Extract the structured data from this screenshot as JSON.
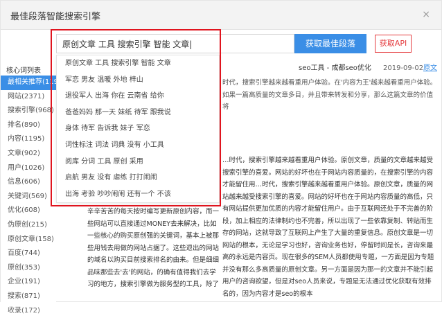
{
  "title": "最佳段落智能搜索引擎",
  "close": "×",
  "search": {
    "value": "原创文章 工具 搜索引擎 智能 文章|",
    "button": "获取最佳段落",
    "api": "获取API"
  },
  "dropdown": [
    "原创文章 工具 搜索引擎 智能 文章",
    "军恋 男友 温暖 外地 梓山",
    "退役军人 出海 你在 云南省 给你",
    "爸爸妈妈 那一天 妹纸 待军 跟我说",
    "身体 待军 告诉我 妹子 军恋",
    "词性标注 词法 词典 没有 小工具",
    "阅库 分词 工具 原创 采用",
    "启航 男友 没有 虐练 打打闹闹",
    "出海 考验 吵吵闹闹 还有一个 不该"
  ],
  "sidebar": {
    "header": "核心词列表",
    "items": [
      "最相关推荐(1194",
      "网站(2371)",
      "搜索引擎(968)",
      "排名(890)",
      "内容(1195)",
      "文章(902)",
      "用户(1026)",
      "信息(606)",
      "关键词(569)",
      "优化(608)",
      "伪原创(215)",
      "原创文章(158)",
      "百度(744)",
      "原创(353)",
      "企业(191)",
      "搜索(871)",
      "收录(172)"
    ]
  },
  "result": {
    "source": "seo工具 - 成都seo优化",
    "date": "2019-09-02",
    "link": "原文"
  },
  "para_right_top": "时代，搜索引擎越来越看重用户体验。在'内容为王'越来越看重用户体验。如果一篇高质量的文章多目，并且带来转发和分享，那么这篇文章的价值将",
  "para_right": "…时代，搜索引擎越来越看重用户体验。原创文章，质量的文章越来越受搜索引擎的喜爱。网站的好坏也在于网站内容质量的，在搜索引擎的内容才能留住用…时代，搜索引擎越来越看重用户体验。原创文章，质量的网站越来越受搜索引擎的喜爱。网站的好坏也在于网站内容质量的高低，只有网站提供更加优质的内容才能留住用户。由于互联网还处于不完善的阶段，加上相应的法律制约也不完善，所以出现了一些依靠复制、转贴而生存的网站，这就导致了互联网上产生了大量的重复信息。原创文章是一切网站的根本，无论是学习也好，咨询业务也好，停留时间是长，咨询来最高的永远是内容页。现在很多的SEM人员都使用专题，一方面是因为专题并没有那么多高质量的原创文章。另一方面是因为那一的文章并不能引起用户的咨询欲望，但是对seo人员来说，专题是无法通过优化获取有效排名的，因为内容才是seo的根本",
  "para_left": "辛辛苦苦的每天按时编写更新原创内容，而一些网站可以直接通过MONEY去来解决，比如一些核心的购买原创强的关键词，基本上被那些用钱去用做的网站占据了。这些退出的网站的域名以购买目前搜索排名的由来。但是细细品味那些去'去'的网站，的确有值得我们去学习的地方，搜索引擎做为服务型的工具，除了"
}
